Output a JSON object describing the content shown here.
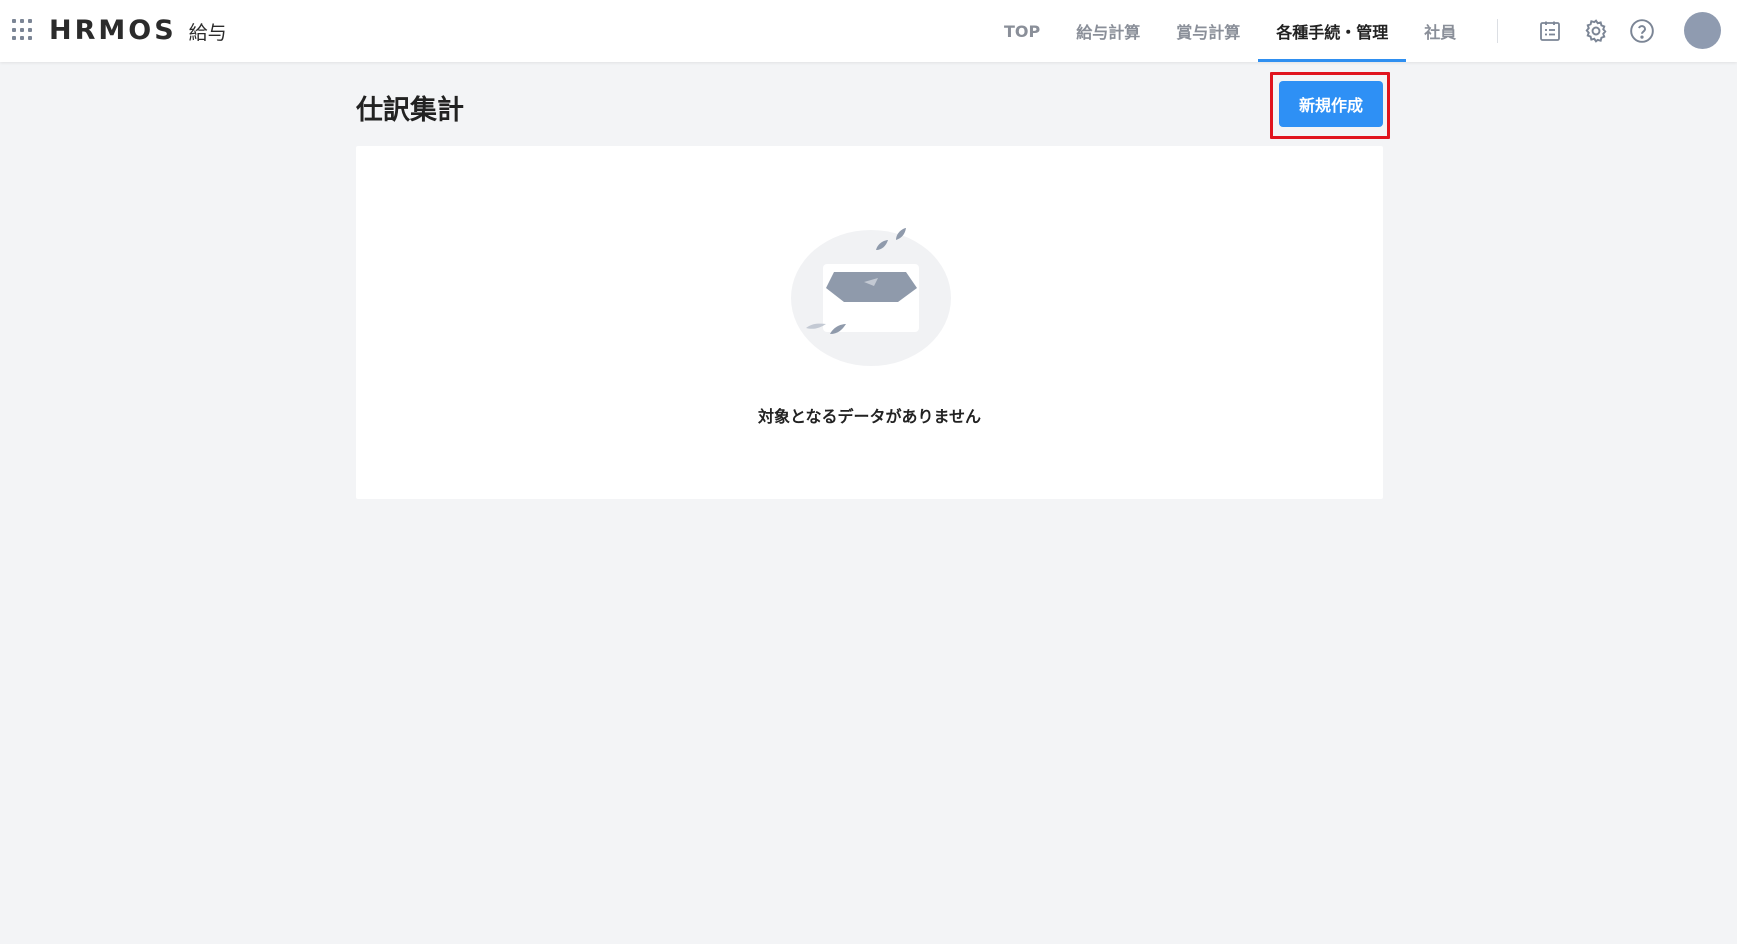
{
  "header": {
    "logo_text": "HRMOS",
    "logo_sub": "給与",
    "nav": [
      {
        "label": "TOP",
        "active": false
      },
      {
        "label": "給与計算",
        "active": false
      },
      {
        "label": "賞与計算",
        "active": false
      },
      {
        "label": "各種手続・管理",
        "active": true
      },
      {
        "label": "社員",
        "active": false
      }
    ],
    "icons": [
      "calendar-list-icon",
      "gear-icon",
      "help-icon",
      "avatar"
    ],
    "accent_color": "#2f8ff0"
  },
  "main": {
    "title": "仕訳集計",
    "create_button_label": "新規作成",
    "empty_message": "対象となるデータがありません"
  },
  "colors": {
    "primary_button": "#2e90f5",
    "highlight_border": "#e0141e",
    "background": "#f3f4f6"
  }
}
